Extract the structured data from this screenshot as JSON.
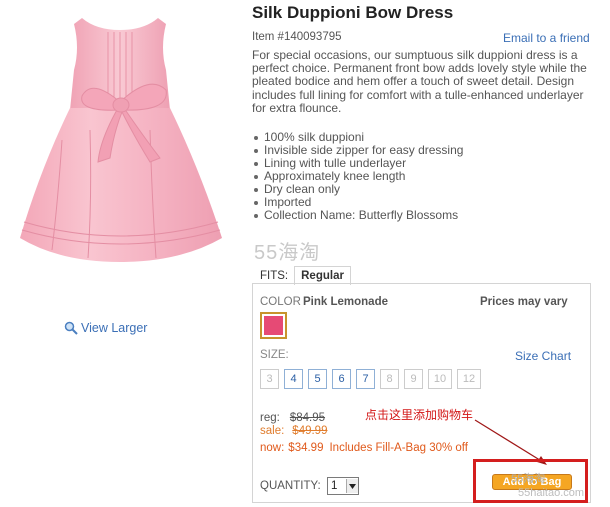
{
  "product": {
    "title": "Silk Duppioni Bow Dress",
    "item_number": "Item #140093795",
    "email_link": "Email to a friend",
    "description": "For special occasions, our sumptuous silk duppioni dress is a perfect choice. Permanent front bow adds lovely style while the pleated bodice and hem offer a touch of sweet detail. Design includes full lining for comfort with a tulle-enhanced underlayer for extra flounce.",
    "features": [
      "100% silk duppioni",
      "Invisible side zipper for easy dressing",
      "Lining with tulle underlayer",
      "Approximately knee length",
      "Dry clean only",
      "Imported",
      "Collection Name: Butterfly Blossoms"
    ],
    "view_larger": "View Larger",
    "image_icon": "magnifier-icon"
  },
  "watermark": {
    "logo_digits": "55",
    "logo_text": "海淘",
    "corner_top": "55海淘",
    "corner_bottom": "55haitao.com"
  },
  "tabs": {
    "fits_label": "FITS:",
    "regular_label": "Regular"
  },
  "options": {
    "color_label": "COLOR",
    "color_name": "Pink Lemonade",
    "prices_vary": "Prices may vary",
    "swatch_color": "#e64a75",
    "size_label": "SIZE:",
    "size_chart": "Size Chart",
    "sizes": [
      "3",
      "4",
      "5",
      "6",
      "7",
      "8",
      "9",
      "10",
      "12"
    ]
  },
  "pricing": {
    "reg_label": "reg:",
    "reg_value": "$84.95",
    "sale_label": "sale:",
    "sale_value": "$49.99",
    "now_label": "now:",
    "now_value": "$34.99",
    "now_note": "Includes Fill-A-Bag 30% off"
  },
  "annotation": {
    "text": "点击这里添加购物车"
  },
  "quantity": {
    "label": "QUANTITY:",
    "value": "1"
  },
  "add_to_bag": {
    "label": "Add to Bag"
  },
  "colors": {
    "dress_pink": "#f6b8c6",
    "link_blue": "#3b6fb6",
    "sale_orange": "#e07c2c",
    "annotation_red": "#d31818",
    "button_orange": "#f5a623"
  }
}
